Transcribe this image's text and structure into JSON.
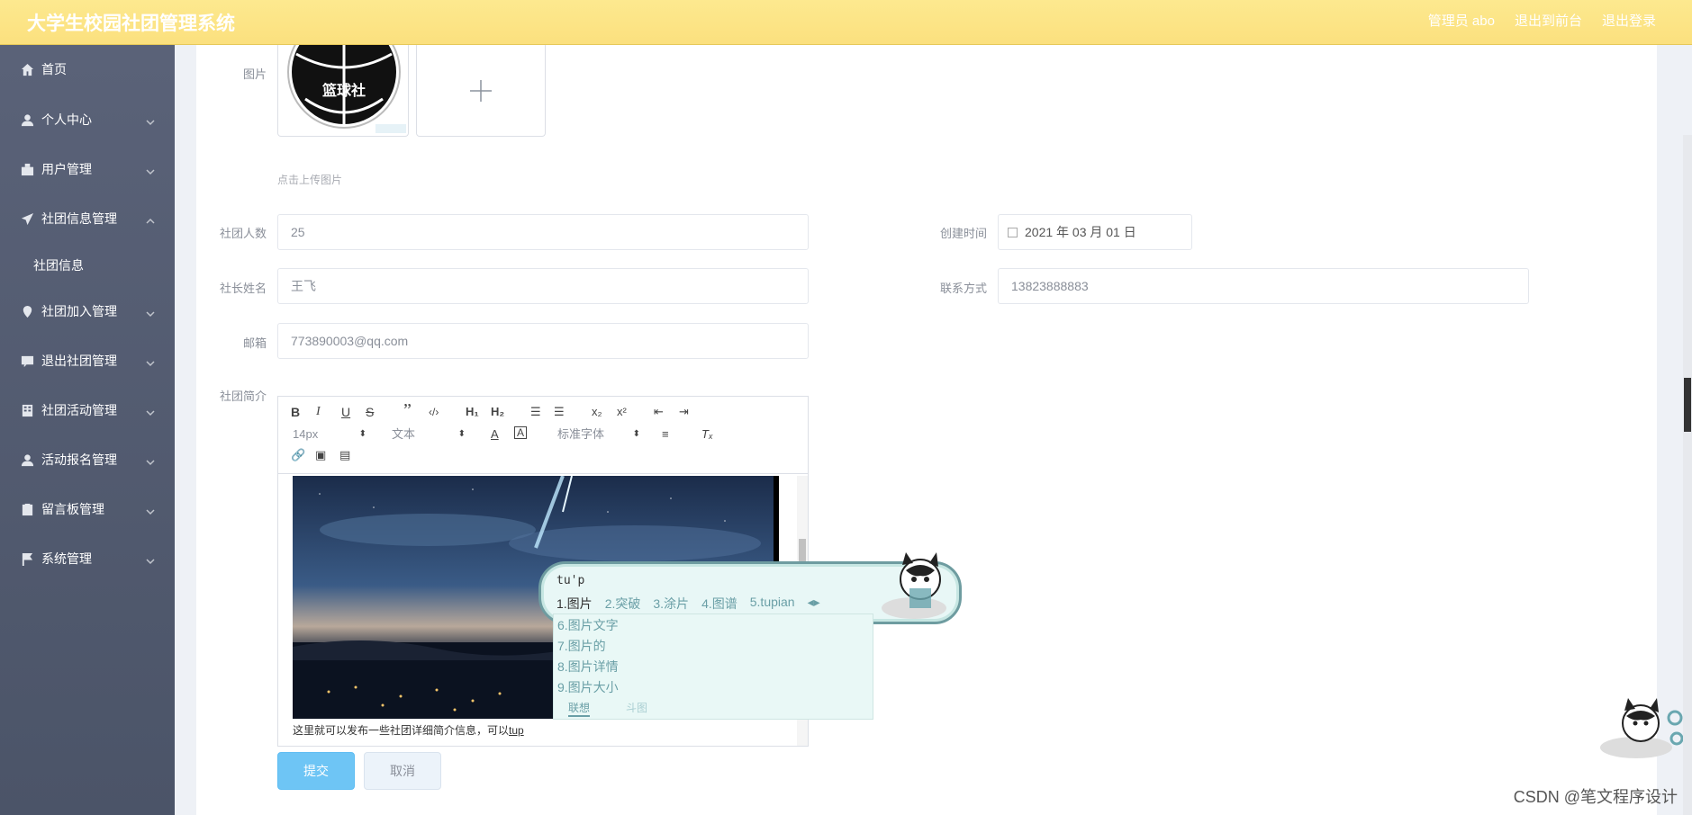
{
  "header": {
    "title": "大学生校园社团管理系统",
    "admin": "管理员 abo",
    "to_front": "退出到前台",
    "logout": "退出登录"
  },
  "sidebar": {
    "items": [
      {
        "label": "首页",
        "icon": "home-icon"
      },
      {
        "label": "个人中心",
        "icon": "user-icon"
      },
      {
        "label": "用户管理",
        "icon": "users-icon"
      },
      {
        "label": "社团信息管理",
        "icon": "send-icon"
      },
      {
        "label": "社团加入管理",
        "icon": "location-icon"
      },
      {
        "label": "退出社团管理",
        "icon": "message-icon"
      },
      {
        "label": "社团活动管理",
        "icon": "building-icon"
      },
      {
        "label": "活动报名管理",
        "icon": "user-icon"
      },
      {
        "label": "留言板管理",
        "icon": "clipboard-icon"
      },
      {
        "label": "系统管理",
        "icon": "flag-icon"
      }
    ],
    "sub_item": "社团信息"
  },
  "form": {
    "image_label": "图片",
    "image_logo_text": "篮球社",
    "upload_hint": "点击上传图片",
    "member_count_label": "社团人数",
    "member_count": "25",
    "created_label": "创建时间",
    "created": "2021 年 03 月 01 日",
    "leader_label": "社长姓名",
    "leader": "王飞",
    "contact_label": "联系方式",
    "contact": "13823888883",
    "email_label": "邮箱",
    "email": "773890003@qq.com",
    "intro_label": "社团简介"
  },
  "editor": {
    "font_size": "14px",
    "text_type": "文本",
    "font_family": "标准字体",
    "content_text": "这里就可以发布一些社团详细简介信息，可以",
    "typed": "tup"
  },
  "buttons": {
    "submit": "提交",
    "cancel": "取消"
  },
  "ime": {
    "input": "tu'p",
    "candidates": [
      "1.图片",
      "2.突破",
      "3.涂片",
      "4.图谱",
      "5.tupian"
    ],
    "more": [
      "6.图片文字",
      "7.图片的",
      "8.图片详情",
      "9.图片大小"
    ],
    "tab_assoc": "联想",
    "tab_meme": "斗图"
  },
  "watermark": "CSDN @笔文程序设计"
}
